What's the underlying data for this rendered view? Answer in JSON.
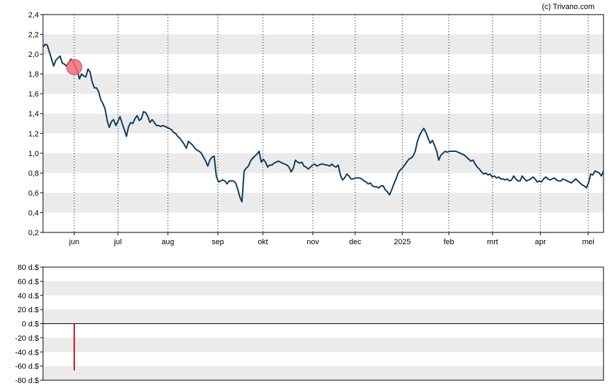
{
  "credit": "(c) Trivano.com",
  "colors": {
    "band": "#ebebeb",
    "price_line": "#0d3a5c",
    "marker": "#f26d78",
    "marker_stroke": "#d0404f",
    "bar_negative": "#d9141e",
    "axis": "#000000"
  },
  "chart_data": [
    {
      "type": "line",
      "name": "price",
      "ylim": [
        0.2,
        2.4
      ],
      "y_ticks": [
        "0,2",
        "0,4",
        "0,6",
        "0,8",
        "1,0",
        "1,2",
        "1,4",
        "1,6",
        "1,8",
        "2,0",
        "2,2",
        "2,4"
      ],
      "x_ticks": [
        "jun",
        "jul",
        "aug",
        "sep",
        "okt",
        "nov",
        "dec",
        "2025",
        "feb",
        "mrt",
        "apr",
        "mei"
      ],
      "grid": "vertical dotted lines at month ticks, alternating horizontal bands",
      "series": [
        {
          "values": [
            2.07,
            2.1,
            2.09,
            2.02,
            1.95,
            1.88,
            1.94,
            1.96,
            1.98,
            1.91,
            1.9,
            1.88,
            1.91,
            1.95,
            1.92,
            1.88,
            1.84,
            1.75,
            1.8,
            1.78,
            1.77,
            1.85,
            1.82,
            1.72,
            1.66,
            1.66,
            1.62,
            1.54,
            1.5,
            1.45,
            1.33,
            1.26,
            1.32,
            1.34,
            1.28,
            1.32,
            1.37,
            1.3,
            1.24,
            1.17,
            1.27,
            1.31,
            1.3,
            1.35,
            1.38,
            1.33,
            1.35,
            1.42,
            1.41,
            1.37,
            1.31,
            1.34,
            1.31,
            1.28,
            1.28,
            1.27,
            1.28,
            1.27,
            1.26,
            1.25,
            1.24,
            1.21,
            1.2,
            1.17,
            1.15,
            1.12,
            1.09,
            1.05,
            1.12,
            1.1,
            1.08,
            1.05,
            1.03,
            1.02,
            1.0,
            0.96,
            0.92,
            0.87,
            0.93,
            0.96,
            0.97,
            0.77,
            0.71,
            0.72,
            0.73,
            0.72,
            0.69,
            0.72,
            0.72,
            0.72,
            0.7,
            0.64,
            0.56,
            0.51,
            0.82,
            0.85,
            0.87,
            0.92,
            0.95,
            0.97,
            0.99,
            1.02,
            0.91,
            0.94,
            0.91,
            0.86,
            0.88,
            0.88,
            0.9,
            0.91,
            0.92,
            0.91,
            0.9,
            0.89,
            0.88,
            0.86,
            0.81,
            0.85,
            0.93,
            0.91,
            0.9,
            0.91,
            0.87,
            0.86,
            0.84,
            0.86,
            0.88,
            0.89,
            0.87,
            0.88,
            0.89,
            0.89,
            0.88,
            0.88,
            0.87,
            0.89,
            0.87,
            0.86,
            0.88,
            0.78,
            0.73,
            0.75,
            0.79,
            0.77,
            0.74,
            0.74,
            0.75,
            0.75,
            0.75,
            0.74,
            0.72,
            0.71,
            0.69,
            0.7,
            0.67,
            0.66,
            0.66,
            0.65,
            0.67,
            0.67,
            0.63,
            0.61,
            0.58,
            0.63,
            0.69,
            0.74,
            0.8,
            0.83,
            0.85,
            0.88,
            0.91,
            0.94,
            0.95,
            0.97,
            1.02,
            1.12,
            1.18,
            1.22,
            1.25,
            1.21,
            1.15,
            1.1,
            1.13,
            1.08,
            1.02,
            0.93,
            0.98,
            1.0,
            1.02,
            1.01,
            1.02,
            1.02,
            1.02,
            1.02,
            1.01,
            1.0,
            0.99,
            0.98,
            0.96,
            0.94,
            0.92,
            0.93,
            0.89,
            0.86,
            0.84,
            0.81,
            0.79,
            0.8,
            0.78,
            0.79,
            0.76,
            0.77,
            0.75,
            0.76,
            0.74,
            0.74,
            0.73,
            0.74,
            0.72,
            0.73,
            0.77,
            0.74,
            0.72,
            0.72,
            0.77,
            0.74,
            0.72,
            0.73,
            0.74,
            0.76,
            0.74,
            0.71,
            0.72,
            0.71,
            0.74,
            0.76,
            0.74,
            0.73,
            0.74,
            0.75,
            0.73,
            0.72,
            0.72,
            0.74,
            0.73,
            0.72,
            0.71,
            0.7,
            0.72,
            0.74,
            0.72,
            0.7,
            0.68,
            0.67,
            0.65,
            0.7,
            0.79,
            0.78,
            0.82,
            0.81,
            0.8,
            0.77,
            0.82
          ]
        }
      ],
      "marker": {
        "date_label": "jun",
        "value": 1.87
      }
    },
    {
      "type": "bar",
      "name": "insider-transactions",
      "ylim": [
        -80,
        80
      ],
      "y_ticks": [
        "80 d.$",
        "60 d.$",
        "40 d.$",
        "20 d.$",
        "0 d.$",
        "-20 d.$",
        "-40 d.$",
        "-60 d.$",
        "-80 d.$"
      ],
      "bars": [
        {
          "x_label": "jun",
          "value": -66
        }
      ]
    }
  ]
}
